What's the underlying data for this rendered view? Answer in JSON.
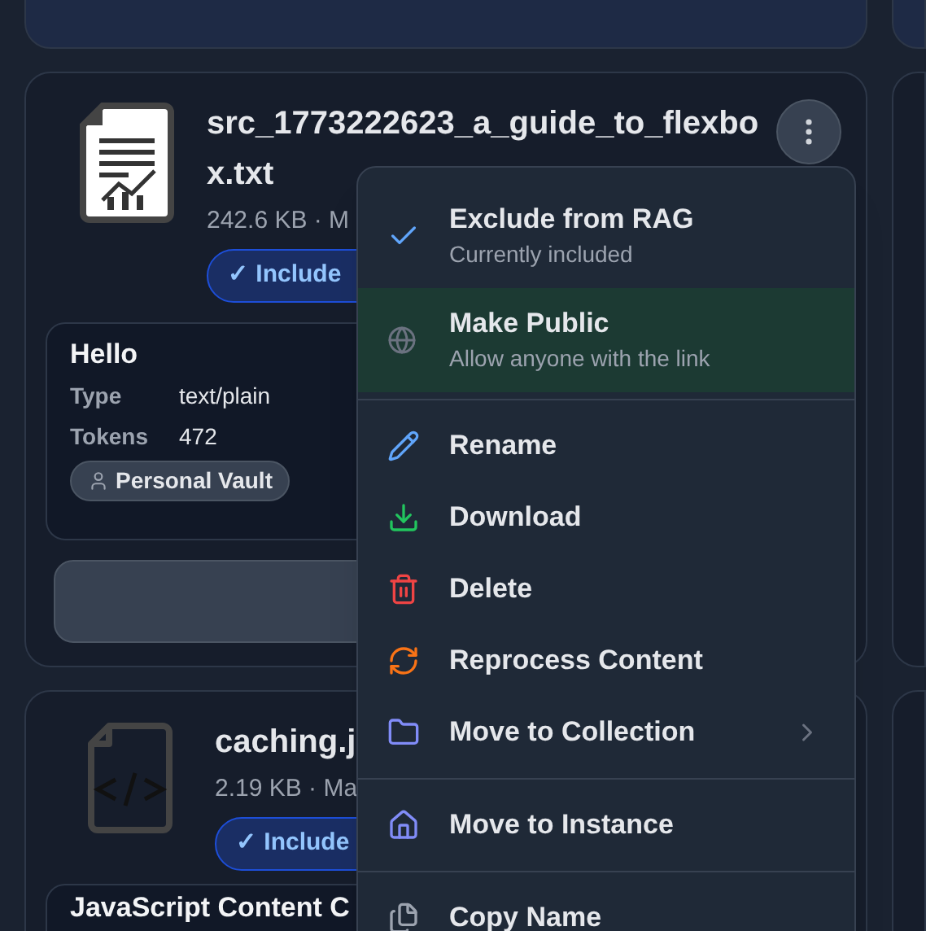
{
  "files": [
    {
      "kind": "document",
      "title": "src_1773222623_a_guide_to_flexbox.txt",
      "meta": "242.6 KB · M",
      "badge": "✓ Include",
      "details": {
        "title": "Hello",
        "rows": [
          {
            "label": "Type",
            "value": "text/plain"
          },
          {
            "label": "Tokens",
            "value": "472"
          }
        ],
        "chip": "Personal Vault"
      },
      "has_button": true
    },
    {
      "kind": "code",
      "title": "caching.j",
      "meta": "2.19 KB · Ma",
      "badge": "✓ Include",
      "details": {
        "title": "JavaScript Content C"
      }
    }
  ],
  "menu": {
    "groups": [
      [
        {
          "label": "Exclude from RAG",
          "sublabel": "Currently included",
          "checked": true,
          "highlighted": false
        },
        {
          "label": "Make Public",
          "sublabel": "Allow anyone with the link",
          "checked": false,
          "highlighted": true
        }
      ],
      [
        {
          "label": "Rename",
          "highlighted": false
        },
        {
          "label": "Download",
          "highlighted": false
        },
        {
          "label": "Delete",
          "highlighted": false
        },
        {
          "label": "Reprocess Content",
          "highlighted": false
        },
        {
          "label": "Move to Collection",
          "submenu": true,
          "highlighted": false
        }
      ],
      [
        {
          "label": "Move to Instance",
          "highlighted": false
        }
      ],
      [
        {
          "label": "Copy Name",
          "highlighted": false
        }
      ]
    ]
  }
}
